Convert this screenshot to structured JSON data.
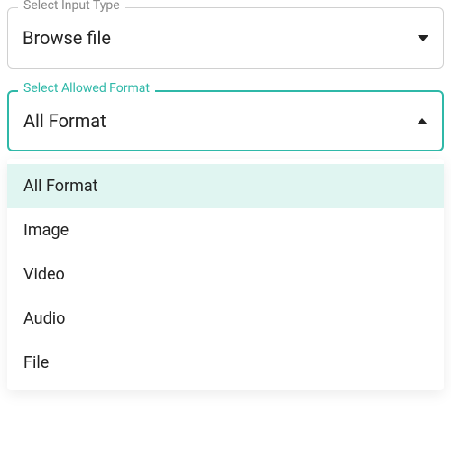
{
  "inputType": {
    "label": "Select Input Type",
    "value": "Browse file"
  },
  "allowedFormat": {
    "label": "Select Allowed Format",
    "value": "All Format",
    "options": [
      "All Format",
      "Image",
      "Video",
      "Audio",
      "File"
    ],
    "selectedIndex": 0
  },
  "colors": {
    "accent": "#2fb8a8",
    "border": "#d0d0d0",
    "text": "#222",
    "labelMuted": "#888",
    "optionSelectedBg": "#e0f5f1"
  }
}
